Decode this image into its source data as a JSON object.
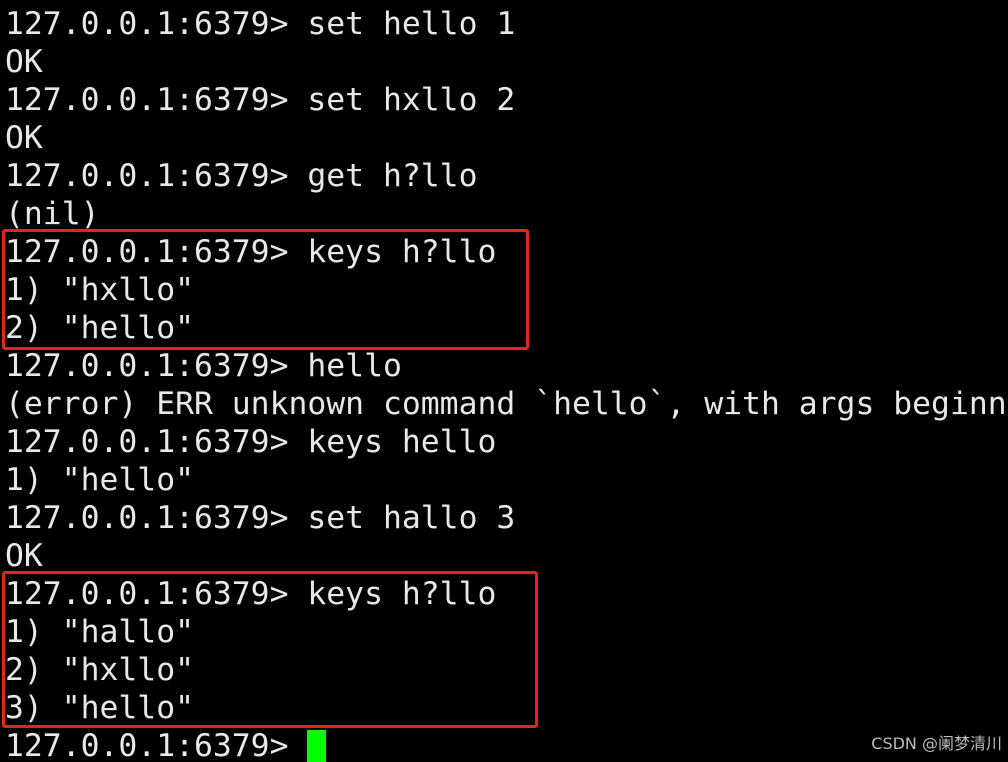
{
  "terminal": {
    "prompt": "127.0.0.1:6379> ",
    "lines": [
      {
        "kind": "command",
        "text": "127.0.0.1:6379> set hello 1"
      },
      {
        "kind": "output",
        "text": "OK"
      },
      {
        "kind": "command",
        "text": "127.0.0.1:6379> set hxllo 2"
      },
      {
        "kind": "output",
        "text": "OK"
      },
      {
        "kind": "command",
        "text": "127.0.0.1:6379> get h?llo"
      },
      {
        "kind": "output",
        "text": "(nil)"
      },
      {
        "kind": "command",
        "text": "127.0.0.1:6379> keys h?llo"
      },
      {
        "kind": "output",
        "text": "1) \"hxllo\""
      },
      {
        "kind": "output",
        "text": "2) \"hello\""
      },
      {
        "kind": "command",
        "text": "127.0.0.1:6379> hello"
      },
      {
        "kind": "error",
        "text": "(error) ERR unknown command `hello`, with args beginn"
      },
      {
        "kind": "command",
        "text": "127.0.0.1:6379> keys hello"
      },
      {
        "kind": "output",
        "text": "1) \"hello\""
      },
      {
        "kind": "command",
        "text": "127.0.0.1:6379> set hallo 3"
      },
      {
        "kind": "output",
        "text": "OK"
      },
      {
        "kind": "command",
        "text": "127.0.0.1:6379> keys h?llo"
      },
      {
        "kind": "output",
        "text": "1) \"hallo\""
      },
      {
        "kind": "output",
        "text": "2) \"hxllo\""
      },
      {
        "kind": "output",
        "text": "3) \"hello\""
      }
    ],
    "current_prompt": "127.0.0.1:6379> ",
    "cursor_color": "#00ff00",
    "highlight_color": "#e8231f"
  },
  "watermark": "CSDN @阑梦清川"
}
